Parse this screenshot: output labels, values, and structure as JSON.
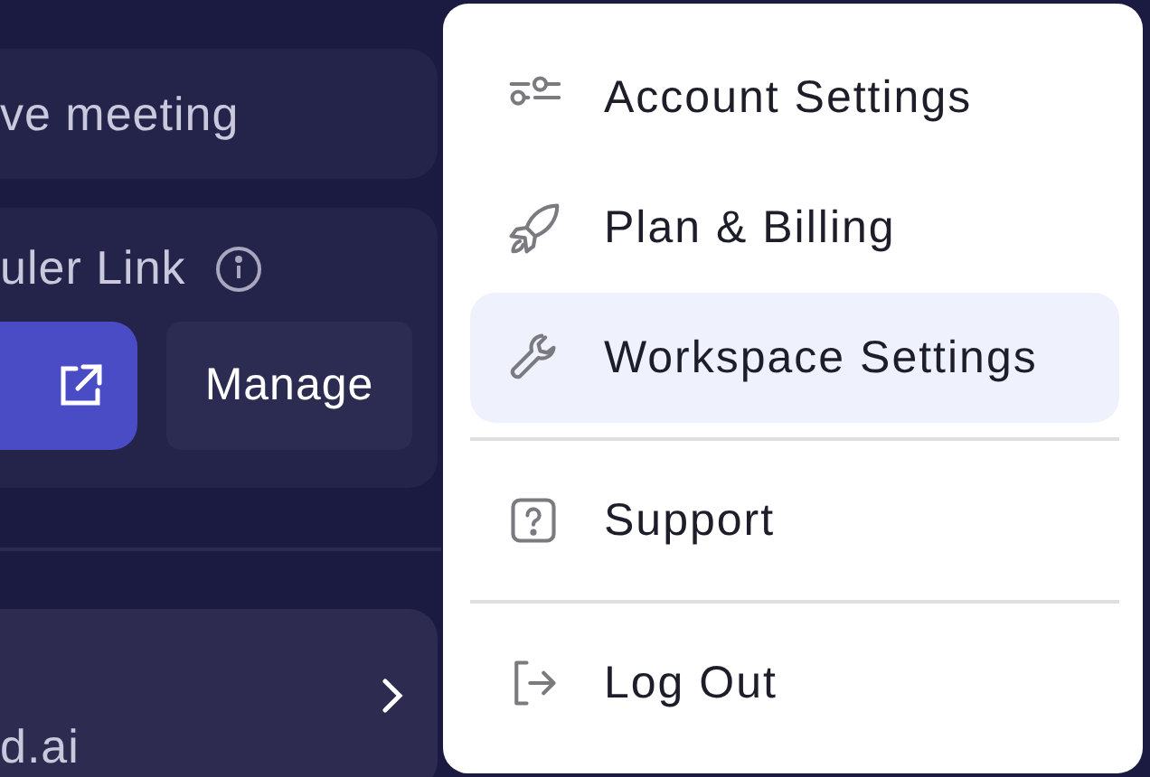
{
  "background": {
    "meeting_card": {
      "text": "ve meeting"
    },
    "scheduler_card": {
      "title": "uler Link",
      "manage_button": "Manage"
    },
    "account_card": {
      "text": "d.ai"
    }
  },
  "menu": {
    "groups": [
      {
        "items": [
          {
            "label": "Account Settings",
            "kind": "sliders",
            "selected": false
          },
          {
            "label": "Plan & Billing",
            "kind": "rocket",
            "selected": false
          },
          {
            "label": "Workspace Settings",
            "kind": "wrench",
            "selected": true
          }
        ]
      },
      {
        "items": [
          {
            "label": "Support",
            "kind": "help",
            "selected": false
          }
        ]
      },
      {
        "items": [
          {
            "label": "Log Out",
            "kind": "logout",
            "selected": false
          }
        ]
      }
    ]
  }
}
